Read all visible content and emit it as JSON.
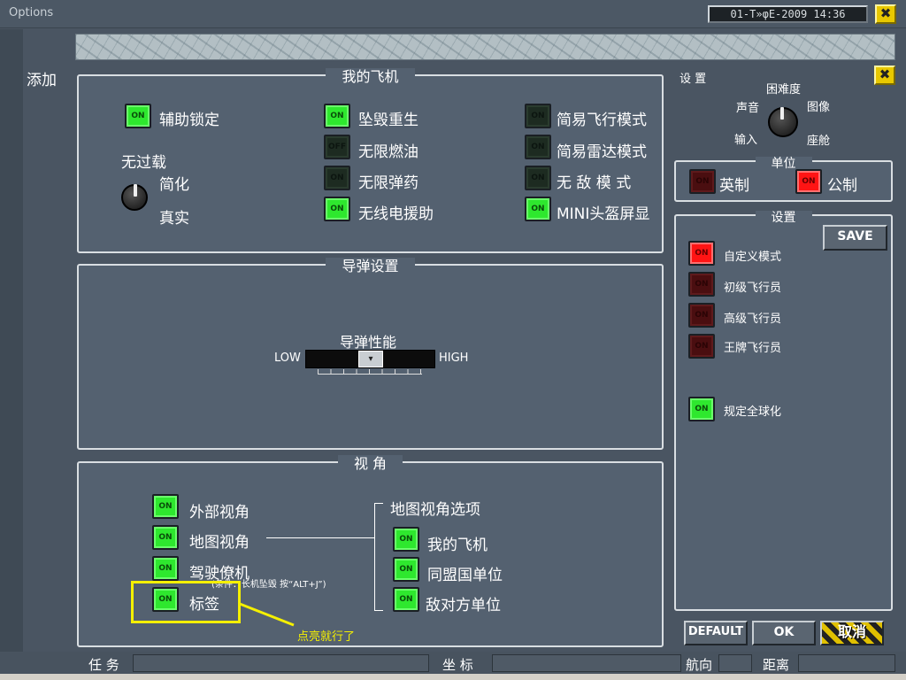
{
  "window": {
    "title": "Options",
    "clock": "01-T»φE-2009  14:36",
    "close_glyph": "✖"
  },
  "left_label": "添加",
  "my_plane": {
    "title": "我的飞机",
    "items": [
      {
        "label": "辅助锁定",
        "led": "ON",
        "state": "on"
      },
      {
        "label": "坠毁重生",
        "led": "ON",
        "state": "on"
      },
      {
        "label": "无限燃油",
        "led": "OFF",
        "state": "dark"
      },
      {
        "label": "无限弹药",
        "led": "ON",
        "state": "dark"
      },
      {
        "label": "无线电援助",
        "led": "ON",
        "state": "on"
      },
      {
        "label": "简易飞行模式",
        "led": "ON",
        "state": "dark"
      },
      {
        "label": "简易雷达模式",
        "led": "ON",
        "state": "dark"
      },
      {
        "label": "无 敌 模 式",
        "led": "ON",
        "state": "dark"
      },
      {
        "label": "MINI头盔屏显",
        "led": "ON",
        "state": "on"
      }
    ],
    "overload_label": "无过载",
    "overload_opts": [
      "简化",
      "真实"
    ]
  },
  "missile": {
    "title": "导弹设置",
    "perf_label": "导弹性能",
    "low": "LOW",
    "high": "HIGH",
    "level": 0.5
  },
  "view": {
    "title": "视 角",
    "items": [
      {
        "label": "外部视角",
        "led": "ON"
      },
      {
        "label": "地图视角",
        "led": "ON"
      },
      {
        "label": "驾驶僚机",
        "led": "ON"
      },
      {
        "label": "标签",
        "led": "ON"
      }
    ],
    "note": "(条件：长机坠毁 按“ALT+J”)",
    "map_title": "地图视角选项",
    "map_items": [
      {
        "label": "我的飞机",
        "led": "ON"
      },
      {
        "label": "同盟国单位",
        "led": "ON"
      },
      {
        "label": "敌对方单位",
        "led": "ON"
      }
    ],
    "annotation": "点亮就行了"
  },
  "right": {
    "settings_label": "设 置",
    "knob_labels": {
      "top": "困难度",
      "left": "声音",
      "right": "图像",
      "bl": "输入",
      "br": "座舱"
    },
    "units": {
      "title": "单位",
      "imperial": "英制",
      "metric": "公制",
      "led": "ON"
    },
    "presets": {
      "title": "设置",
      "save": "SAVE",
      "items": [
        {
          "label": "自定义模式",
          "led": "ON",
          "state": "red"
        },
        {
          "label": "初级飞行员",
          "led": "ON",
          "state": "dred"
        },
        {
          "label": "高级飞行员",
          "led": "ON",
          "state": "dred"
        },
        {
          "label": "王牌飞行员",
          "led": "ON",
          "state": "dred"
        }
      ],
      "globalize": {
        "label": "规定全球化",
        "led": "ON"
      }
    }
  },
  "buttons": {
    "default": "DEFAULT",
    "ok": "OK",
    "cancel": "取消"
  },
  "statusbar": {
    "task": "任 务",
    "coord": "坐 标",
    "heading": "航向",
    "distance": "距离"
  }
}
